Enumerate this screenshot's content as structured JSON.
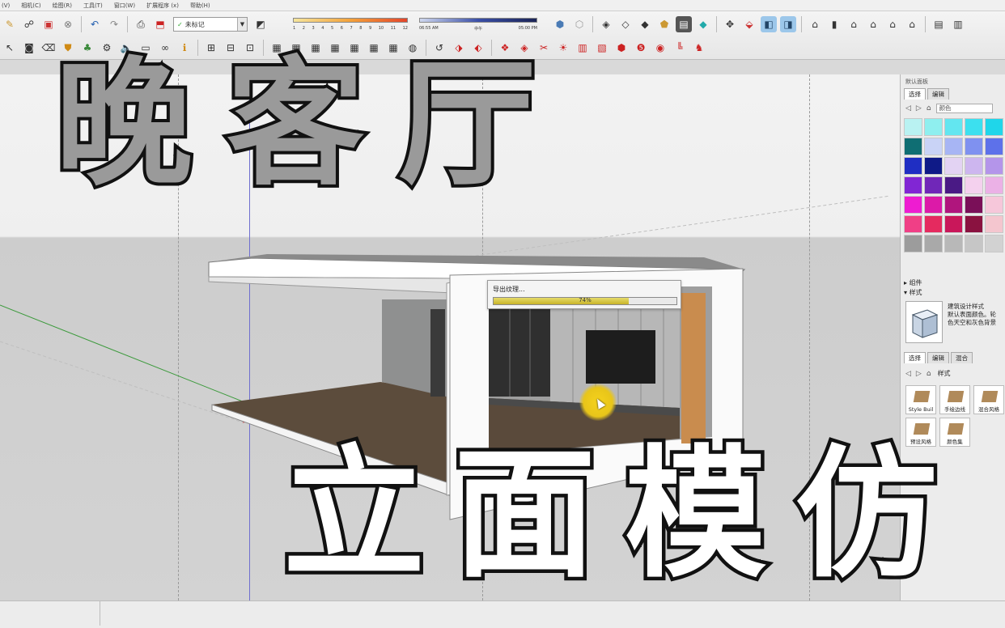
{
  "menu": [
    "(V)",
    "相机(C)",
    "绘图(R)",
    "工具(T)",
    "窗口(W)",
    "扩展程序 (x)",
    "帮助(H)"
  ],
  "toolbar": {
    "layer_value": "未标记",
    "shadow_months": [
      "1",
      "2",
      "3",
      "4",
      "5",
      "6",
      "7",
      "8",
      "9",
      "10",
      "11",
      "12"
    ],
    "time_start": "06:55 AM",
    "time_mid": "中午",
    "time_end": "05:00 PM"
  },
  "overlay": {
    "title_line1": "晚客厅",
    "title_line2": "立面模仿"
  },
  "dialog": {
    "title": "导出纹理...",
    "percent_label": "74%",
    "progress": 0.74
  },
  "tray": {
    "panel_title": "默认面板",
    "materials_tabs": [
      "选择",
      "编辑"
    ],
    "materials_dropdown": "颜色",
    "colors": [
      "#b9f2f2",
      "#8fefef",
      "#63e6f0",
      "#3ce0ef",
      "#1fd6ea",
      "#0f6e73",
      "#c9d3f6",
      "#a7b5f4",
      "#7f91f0",
      "#5d71ea",
      "#1f2ec3",
      "#0f1a87",
      "#e3d3f3",
      "#cdb6ef",
      "#b495ea",
      "#8126d4",
      "#7027b8",
      "#4a1a85",
      "#f4d1ee",
      "#ebb1e6",
      "#ee1cd1",
      "#dc1aa8",
      "#b0157d",
      "#7a0f58",
      "#f6c7da",
      "#f03f86",
      "#e52a5f",
      "#c9175a",
      "#8a1240",
      "#f4c6cf",
      "#9c9c9c",
      "#a9a9a9",
      "#b8b8b8",
      "#c6c6c6",
      "#d2d2d2"
    ],
    "components_label": "组件",
    "styles_label": "样式",
    "style_name": "建筑设计样式",
    "style_desc_line1": "默认表面颜色。轮",
    "style_desc_line2": "色天空和灰色背景",
    "styles_tabs": [
      "选择",
      "编辑",
      "混合"
    ],
    "styles_dropdown": "样式",
    "style_thumbs": [
      "Style Buil",
      "手绘边线",
      "混合风格",
      "预设风格",
      "颜色集"
    ]
  }
}
